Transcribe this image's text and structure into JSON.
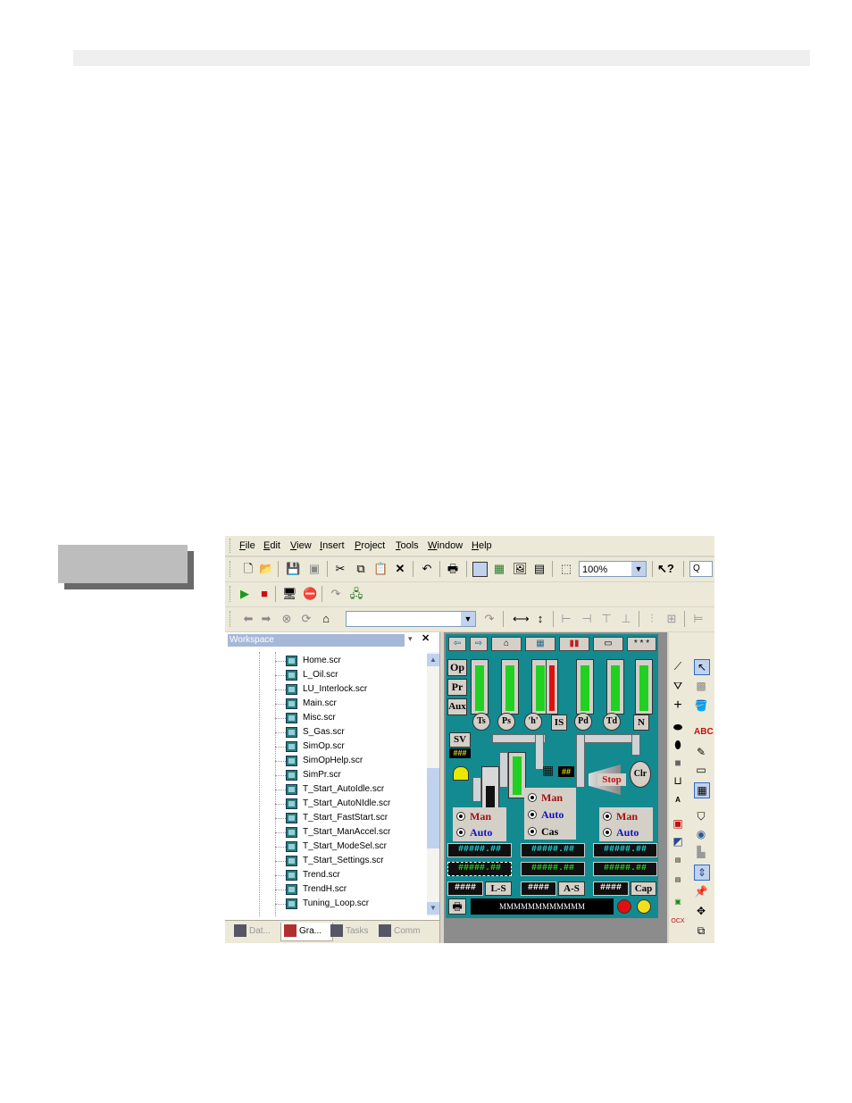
{
  "menu": [
    "File",
    "Edit",
    "View",
    "Insert",
    "Project",
    "Tools",
    "Window",
    "Help"
  ],
  "menu_underline": [
    "F",
    "E",
    "V",
    "I",
    "P",
    "T",
    "W",
    "H"
  ],
  "menu_rest": [
    "ile",
    "dit",
    "iew",
    "nsert",
    "roject",
    "ools",
    "indow",
    "elp"
  ],
  "toolbar": {
    "zoom": "100%",
    "find": "Q"
  },
  "workspace": {
    "title": "Workspace",
    "files": [
      "Home.scr",
      "L_Oil.scr",
      "LU_Interlock.scr",
      "Main.scr",
      "Misc.scr",
      "S_Gas.scr",
      "SimOp.scr",
      "SimOpHelp.scr",
      "SimPr.scr",
      "T_Start_AutoIdle.scr",
      "T_Start_AutoNIdle.scr",
      "T_Start_FastStart.scr",
      "T_Start_ManAccel.scr",
      "T_Start_ModeSel.scr",
      "T_Start_Settings.scr",
      "Trend.scr",
      "TrendH.scr",
      "Tuning_Loop.scr"
    ],
    "tabs": [
      "Dat...",
      "Gra...",
      "Tasks",
      "Comm"
    ]
  },
  "screen": {
    "nav_dots": "* * *",
    "left_buttons": [
      "Op",
      "Pr",
      "Aux"
    ],
    "circles": [
      "Ts",
      "Ps",
      "'h'",
      "Pd",
      "Td"
    ],
    "squares": [
      "IS",
      "N"
    ],
    "sv": "SV",
    "hash3": "###",
    "clr": "Clr",
    "stop": "Stop",
    "hash_small": "##",
    "radio_labels": {
      "man": "Man",
      "auto": "Auto",
      "cas": "Cas"
    },
    "readout": "#####.##",
    "hash4": "####",
    "labels": [
      "L-S",
      "A-S",
      "Cap"
    ],
    "message": "MMMMMMMMMMMM",
    "colors": {
      "screen_bg": "#138a8f",
      "bar_fill": "#22d022",
      "bar_red": "#e01010",
      "readout_cyan": "#22e0e0",
      "man": "#a01010",
      "auto": "#1010c0"
    }
  }
}
